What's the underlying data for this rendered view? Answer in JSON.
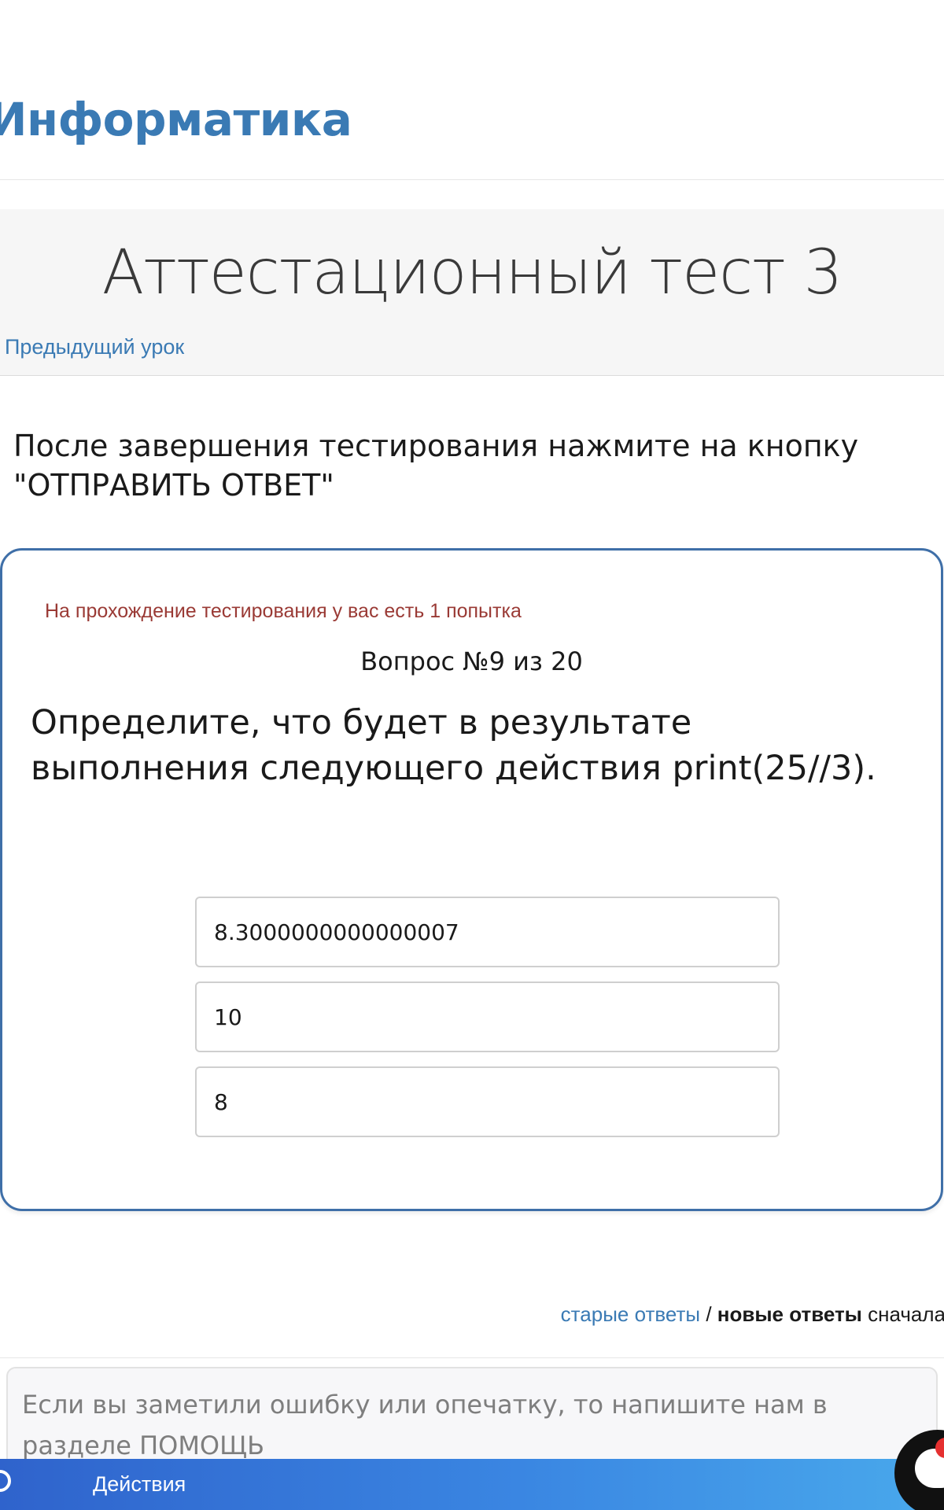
{
  "site": {
    "title": "Информатика"
  },
  "lesson": {
    "title": "Аттестационный тест 3",
    "prev_link": "Предыдущий урок"
  },
  "instruction": "После завершения тестирования нажмите на кнопку \"ОТПРАВИТЬ ОТВЕТ\"",
  "quiz": {
    "attempts_note": "На прохождение тестирования у вас есть 1 попытка",
    "counter": "Вопрос №9 из 20",
    "question": "Определите, что будет в результате выполнения следующего действия print(25//3).",
    "answers": [
      "8.3000000000000007",
      "10",
      "8"
    ]
  },
  "sorting": {
    "old_label": "старые ответы",
    "separator": " / ",
    "new_label": "новые ответы",
    "suffix": " сначала"
  },
  "comment": {
    "text": "Если вы заметили ошибку или опечатку, то напишите нам в разделе ПОМОЩЬ"
  },
  "bottom_bar": {
    "label": "Действия",
    "icon": "search-icon"
  },
  "chat": {
    "icon": "chat-icon"
  },
  "colors": {
    "brand": "#3a7ab4",
    "card_border": "#3f6fa8",
    "note": "#9a3a35",
    "bar": "#2f63cc"
  }
}
